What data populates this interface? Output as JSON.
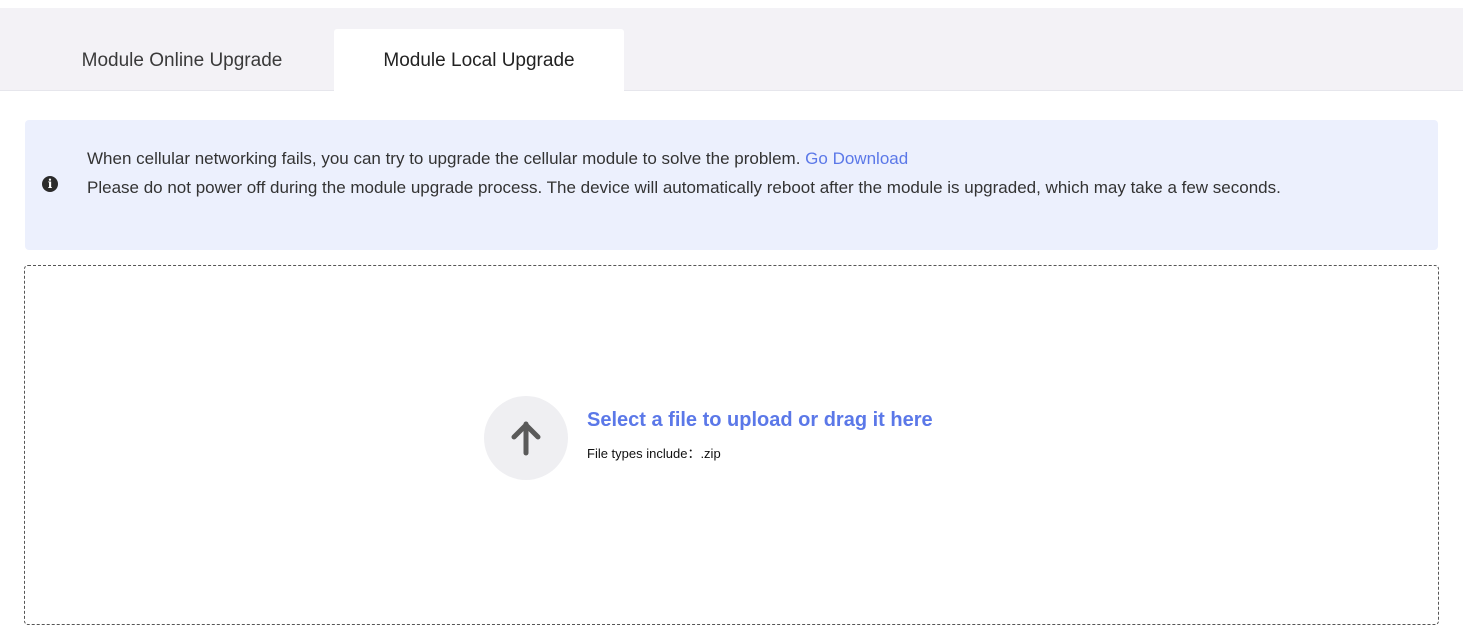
{
  "tabs": [
    {
      "label": "Module Online Upgrade",
      "active": false
    },
    {
      "label": "Module Local Upgrade",
      "active": true
    }
  ],
  "notice": {
    "icon": "info-icon",
    "line1": "When cellular networking fails, you can try to upgrade the cellular module to solve the problem.",
    "link": "Go Download",
    "line2": "Please do not power off during the module upgrade process. The device will automatically reboot after the module is upgraded, which may take a few seconds."
  },
  "upload": {
    "icon": "arrow-up-icon",
    "title": "Select a file to upload or drag it here",
    "file_types": "File types include：.zip"
  },
  "colors": {
    "accent": "#5b78e8",
    "notice_bg": "#ecf0fd",
    "tab_bar_bg": "#f3f2f6"
  }
}
